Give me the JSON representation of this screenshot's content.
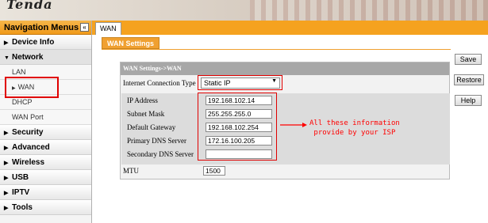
{
  "brand": {
    "logo": "Tenda"
  },
  "sidebar": {
    "header": "Navigation Menus",
    "collapse_glyph": "«",
    "items": [
      {
        "label": "Device Info",
        "glyph": "▶"
      },
      {
        "label": "Network",
        "glyph": "▼"
      },
      {
        "label": "LAN",
        "glyph": ""
      },
      {
        "label": "WAN",
        "glyph": "▶"
      },
      {
        "label": "DHCP",
        "glyph": ""
      },
      {
        "label": "WAN Port",
        "glyph": ""
      },
      {
        "label": "Security",
        "glyph": "▶"
      },
      {
        "label": "Advanced",
        "glyph": "▶"
      },
      {
        "label": "Wireless",
        "glyph": "▶"
      },
      {
        "label": "USB",
        "glyph": "▶"
      },
      {
        "label": "IPTV",
        "glyph": "▶"
      },
      {
        "label": "Tools",
        "glyph": "▶"
      }
    ]
  },
  "topbar": {
    "tab": "WAN"
  },
  "main": {
    "section_title": "WAN Settings",
    "panel_header": "WAN Settings->WAN",
    "connection": {
      "label": "Internet Connection Type",
      "value": "Static IP",
      "dropdown_glyph": "▼"
    },
    "fields": [
      {
        "label": "IP Address",
        "value": "192.168.102.14"
      },
      {
        "label": "Subnet Mask",
        "value": "255.255.255.0"
      },
      {
        "label": "Default Gateway",
        "value": "192.168.102.254"
      },
      {
        "label": "Primary DNS Server",
        "value": "172.16.100.205"
      },
      {
        "label": "Secondary DNS Server",
        "value": ""
      }
    ],
    "mtu": {
      "label": "MTU",
      "value": "1500"
    }
  },
  "annotation": {
    "line1": "All these information",
    "line2": "provide by your ISP",
    "color": "#ff0000"
  },
  "buttons": {
    "save": "Save",
    "restore": "Restore",
    "help": "Help"
  },
  "colors": {
    "accent": "#f5a21f",
    "highlight": "#e00000"
  }
}
